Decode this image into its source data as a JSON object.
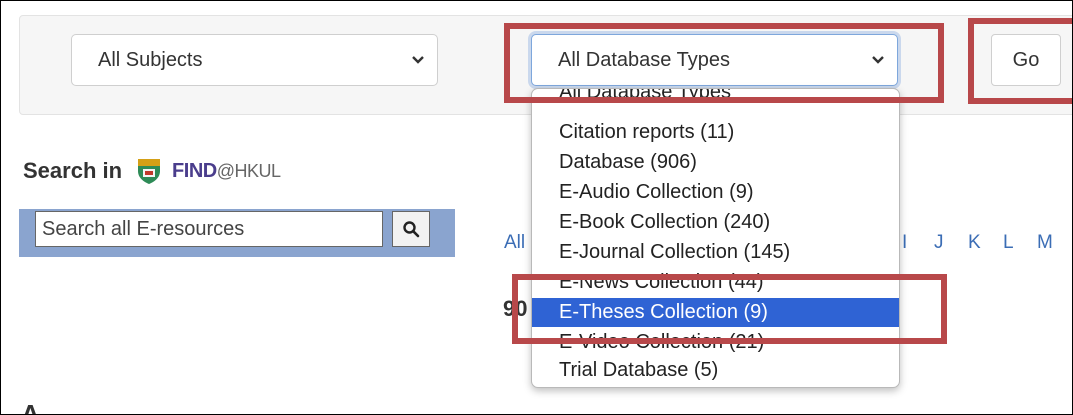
{
  "filters": {
    "subjects": {
      "selected": "All Subjects"
    },
    "database_types": {
      "selected": "All Database Types",
      "options": [
        "All Database Types",
        "Citation reports (11)",
        "Database (906)",
        "E-Audio Collection (9)",
        "E-Book Collection (240)",
        "E-Journal Collection (145)",
        "E-News Collection (44)",
        "E-Theses Collection (9)",
        "E-Video Collection (21)",
        "Trial Database (5)"
      ],
      "highlighted_option": "E-Theses Collection (9)"
    },
    "go_label": "Go"
  },
  "search": {
    "label": "Search in",
    "brand": "FIND",
    "brand_suffix": "@HKUL",
    "placeholder": "Search all E-resources"
  },
  "alphabet": [
    "All",
    "I",
    "J",
    "K",
    "L",
    "M"
  ],
  "fragments": {
    "count_partial": "90",
    "corner": "A"
  },
  "colors": {
    "highlight": "#b8484a",
    "selected_option": "#2f63d4",
    "search_bar": "#8aa4cf"
  }
}
